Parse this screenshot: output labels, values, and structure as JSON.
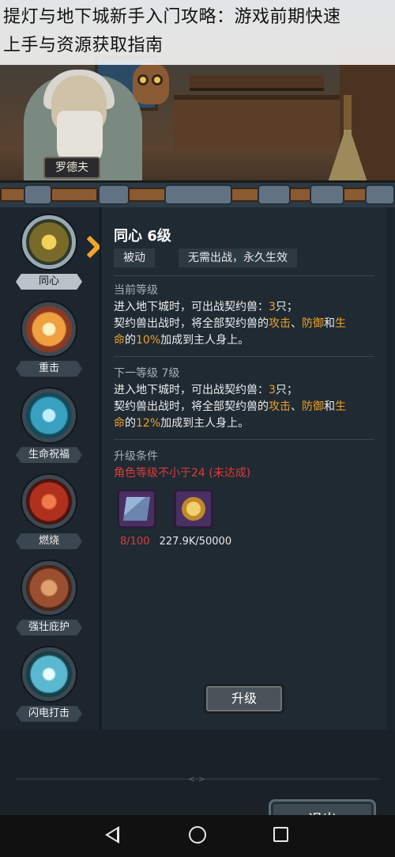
{
  "overlay": {
    "title_line1": "提灯与地下城新手入门攻略：游戏前期快速",
    "title_line2": "上手与资源获取指南"
  },
  "scene": {
    "npc_name": "罗德夫"
  },
  "skills": [
    {
      "label": "同心",
      "icon": "sun-icon",
      "color": "#c9a53a",
      "active": true
    },
    {
      "label": "重击",
      "icon": "burst-icon",
      "color": "#e8a04a",
      "active": false
    },
    {
      "label": "生命祝福",
      "icon": "water-drop-icon",
      "color": "#3aa0c0",
      "active": false
    },
    {
      "label": "燃烧",
      "icon": "flame-swirl-icon",
      "color": "#c04a2a",
      "active": false
    },
    {
      "label": "强壮庇护",
      "icon": "fist-shield-icon",
      "color": "#b0663a",
      "active": false
    },
    {
      "label": "闪电打击",
      "icon": "lightning-icon",
      "color": "#5ab8d0",
      "active": false
    }
  ],
  "detail": {
    "title": "同心 6级",
    "tag_type": "被动",
    "tag_note": "无需出战，永久生效",
    "current_header": "当前等级",
    "current_line1_a": "进入地下城时，可出战契约兽：",
    "current_line1_num": "3",
    "current_line1_b": "只；",
    "current_line2_a": "契约兽出战时，将全部契约兽的",
    "current_line2_attack": "攻击",
    "current_line2_sep": "、",
    "current_line2_defense": "防御",
    "current_line2_and": "和",
    "current_line2_life": "生",
    "current_line3_life": "命",
    "current_line3_pre": "的",
    "current_line3_pct": "10%",
    "current_line3_b": "加成到主人身上。",
    "next_header": "下一等级 7级",
    "next_line1_a": "进入地下城时，可出战契约兽：",
    "next_line1_num": "3",
    "next_line1_b": "只；",
    "next_line2_a": "契约兽出战时，将全部契约兽的",
    "next_line2_attack": "攻击",
    "next_line2_sep": "、",
    "next_line2_defense": "防御",
    "next_line2_and": "和",
    "next_line2_life": "生",
    "next_line3_life": "命",
    "next_line3_pre": "的",
    "next_line3_pct": "12%",
    "next_line3_b": "加成到主人身上。",
    "upgrade_header": "升级条件",
    "upgrade_condition": "角色等级不小于24 (未达成)",
    "items": [
      {
        "icon": "scroll-map-icon"
      },
      {
        "icon": "gold-coin-icon"
      }
    ],
    "count1_have": "8",
    "count1_need": "/100",
    "count2": "227.9K/50000",
    "upgrade_button": "升级"
  },
  "bottom": {
    "divider_mark": "<·>",
    "exit_button": "退出"
  },
  "colors": {
    "accent_orange": "#f1a128",
    "alert_red": "#e23b3b",
    "panel_bg": "#1f2a32"
  }
}
